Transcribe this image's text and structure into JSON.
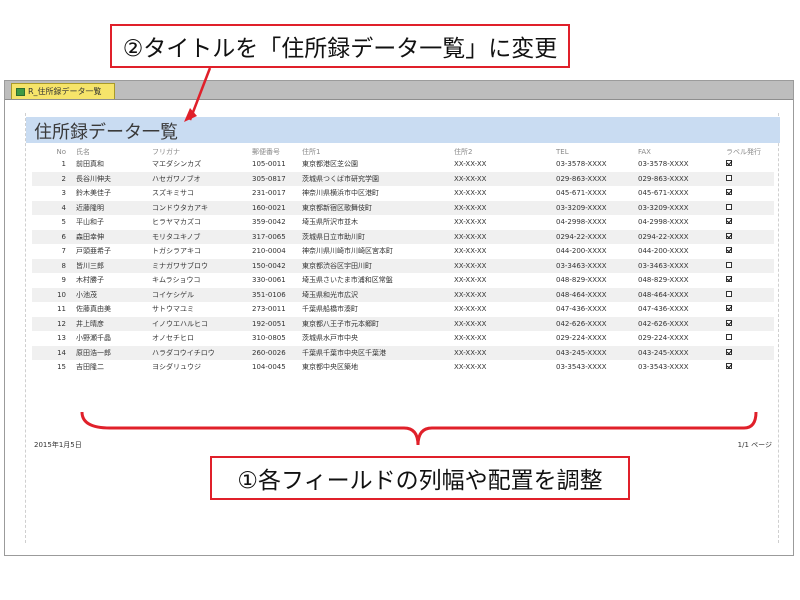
{
  "annotations": {
    "top": "②タイトルを「住所録データ一覧」に変更",
    "bottom": "①各フィールドの列幅や配置を調整"
  },
  "tab": {
    "label": "R_住所録データ一覧"
  },
  "report": {
    "title": "住所録データ一覧",
    "headers": [
      "No",
      "氏名",
      "フリガナ",
      "郵便番号",
      "住所1",
      "住所2",
      "TEL",
      "FAX",
      "ラベル発行"
    ],
    "rows": [
      {
        "no": "1",
        "name": "前田真和",
        "kana": "マエダシンカズ",
        "zip": "105-0011",
        "addr1": "東京都港区芝公園",
        "addr2": "XX-XX-XX",
        "tel": "03-3578-XXXX",
        "fax": "03-3578-XXXX",
        "label": true
      },
      {
        "no": "2",
        "name": "長谷川伸夫",
        "kana": "ハセガワノブオ",
        "zip": "305-0817",
        "addr1": "茨城県つくば市研究学園",
        "addr2": "XX-XX-XX",
        "tel": "029-863-XXXX",
        "fax": "029-863-XXXX",
        "label": false
      },
      {
        "no": "3",
        "name": "鈴木美佳子",
        "kana": "スズキミサコ",
        "zip": "231-0017",
        "addr1": "神奈川県横浜市中区港町",
        "addr2": "XX-XX-XX",
        "tel": "045-671-XXXX",
        "fax": "045-671-XXXX",
        "label": true
      },
      {
        "no": "4",
        "name": "近藤隆明",
        "kana": "コンドウタカアキ",
        "zip": "160-0021",
        "addr1": "東京都新宿区歌舞伎町",
        "addr2": "XX-XX-XX",
        "tel": "03-3209-XXXX",
        "fax": "03-3209-XXXX",
        "label": false
      },
      {
        "no": "5",
        "name": "平山和子",
        "kana": "ヒラヤマカズコ",
        "zip": "359-0042",
        "addr1": "埼玉県所沢市並木",
        "addr2": "XX-XX-XX",
        "tel": "04-2998-XXXX",
        "fax": "04-2998-XXXX",
        "label": true
      },
      {
        "no": "6",
        "name": "森田幸伸",
        "kana": "モリタユキノブ",
        "zip": "317-0065",
        "addr1": "茨城県日立市助川町",
        "addr2": "XX-XX-XX",
        "tel": "0294-22-XXXX",
        "fax": "0294-22-XXXX",
        "label": true
      },
      {
        "no": "7",
        "name": "戸頭亜希子",
        "kana": "トガシラアキコ",
        "zip": "210-0004",
        "addr1": "神奈川県川崎市川崎区宮本町",
        "addr2": "XX-XX-XX",
        "tel": "044-200-XXXX",
        "fax": "044-200-XXXX",
        "label": true
      },
      {
        "no": "8",
        "name": "皆川三郎",
        "kana": "ミナガワサブロウ",
        "zip": "150-0042",
        "addr1": "東京都渋谷区宇田川町",
        "addr2": "XX-XX-XX",
        "tel": "03-3463-XXXX",
        "fax": "03-3463-XXXX",
        "label": false
      },
      {
        "no": "9",
        "name": "木村勝子",
        "kana": "キムラショウコ",
        "zip": "330-0061",
        "addr1": "埼玉県さいたま市浦和区常盤",
        "addr2": "XX-XX-XX",
        "tel": "048-829-XXXX",
        "fax": "048-829-XXXX",
        "label": true
      },
      {
        "no": "10",
        "name": "小池茂",
        "kana": "コイケシゲル",
        "zip": "351-0106",
        "addr1": "埼玉県和光市広沢",
        "addr2": "XX-XX-XX",
        "tel": "048-464-XXXX",
        "fax": "048-464-XXXX",
        "label": false
      },
      {
        "no": "11",
        "name": "佐藤真由美",
        "kana": "サトウマユミ",
        "zip": "273-0011",
        "addr1": "千葉県船橋市湊町",
        "addr2": "XX-XX-XX",
        "tel": "047-436-XXXX",
        "fax": "047-436-XXXX",
        "label": true
      },
      {
        "no": "12",
        "name": "井上晴彦",
        "kana": "イノウエハルヒコ",
        "zip": "192-0051",
        "addr1": "東京都八王子市元本郷町",
        "addr2": "XX-XX-XX",
        "tel": "042-626-XXXX",
        "fax": "042-626-XXXX",
        "label": true
      },
      {
        "no": "13",
        "name": "小野瀬千晶",
        "kana": "オノセチヒロ",
        "zip": "310-0805",
        "addr1": "茨城県水戸市中央",
        "addr2": "XX-XX-XX",
        "tel": "029-224-XXXX",
        "fax": "029-224-XXXX",
        "label": false
      },
      {
        "no": "14",
        "name": "原田浩一郎",
        "kana": "ハラダコウイチロウ",
        "zip": "260-0026",
        "addr1": "千葉県千葉市中央区千葉港",
        "addr2": "XX-XX-XX",
        "tel": "043-245-XXXX",
        "fax": "043-245-XXXX",
        "label": true
      },
      {
        "no": "15",
        "name": "吉田隆二",
        "kana": "ヨシダリュウジ",
        "zip": "104-0045",
        "addr1": "東京都中央区築地",
        "addr2": "XX-XX-XX",
        "tel": "03-3543-XXXX",
        "fax": "03-3543-XXXX",
        "label": true
      }
    ],
    "footer_date": "2015年1月5日",
    "footer_page": "1/1 ページ"
  },
  "colors": {
    "annotation": "#e0202a",
    "title_band": "#c9dcf2",
    "tab": "#f6e46a"
  },
  "icons": [
    "report-icon",
    "checkbox-icon"
  ]
}
